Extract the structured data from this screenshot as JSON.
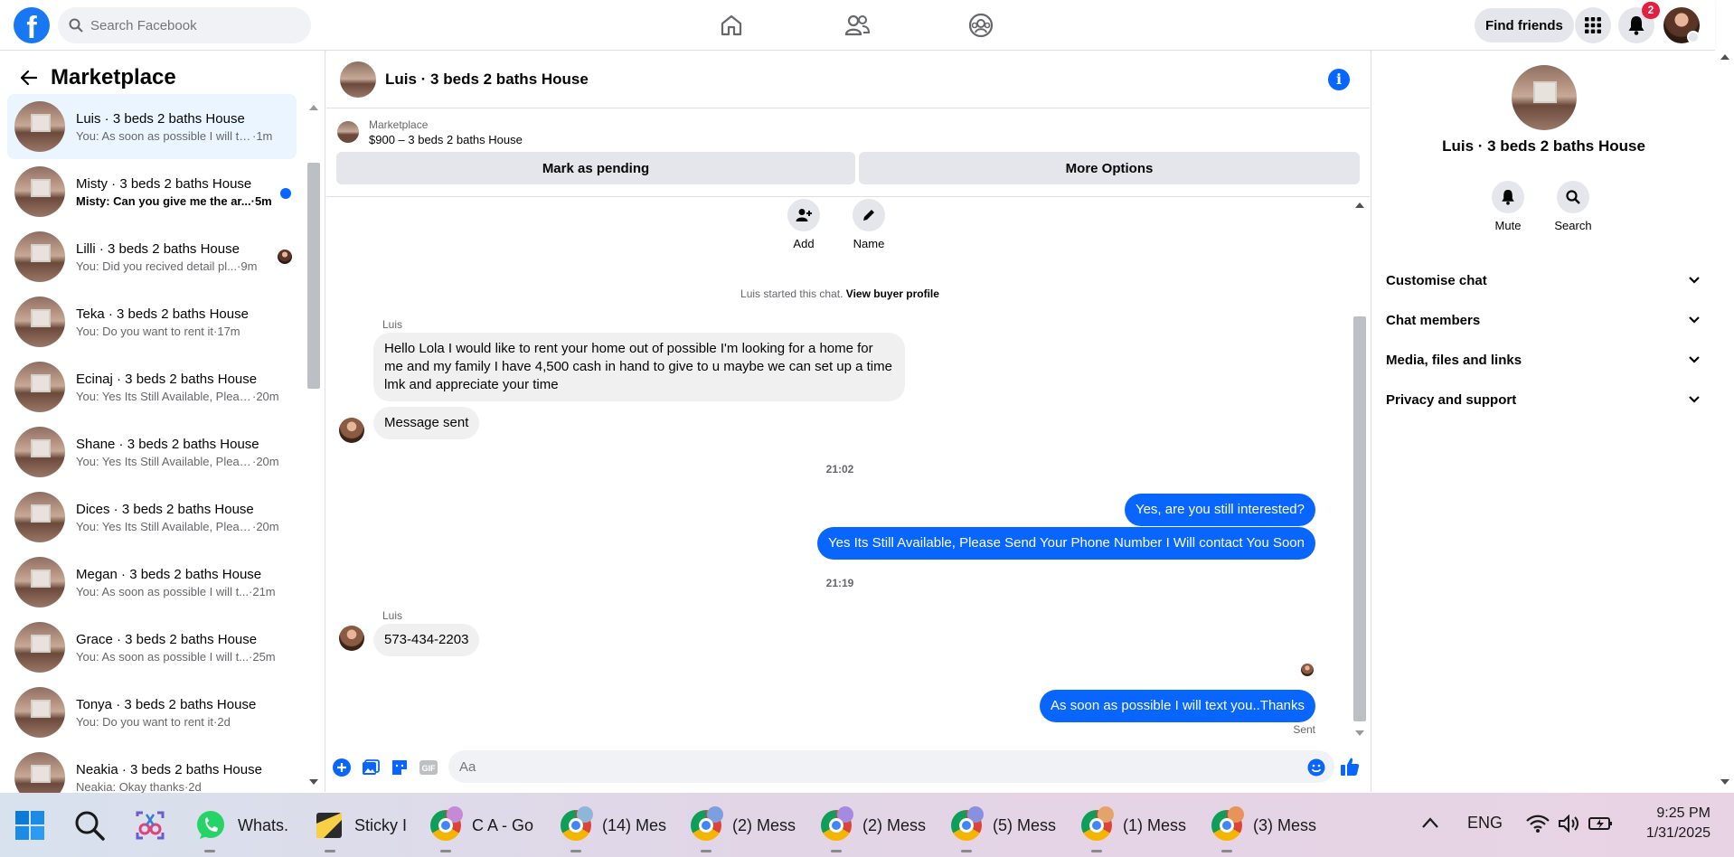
{
  "topbar": {
    "logo_letter": "f",
    "search_placeholder": "Search Facebook",
    "find_friends_label": "Find friends",
    "notification_count": "2",
    "nav_icons": [
      "home-icon",
      "friends-icon",
      "groups-icon"
    ]
  },
  "sidebar": {
    "title": "Marketplace",
    "conversations": [
      {
        "name": "Luis · 3 beds 2 baths House",
        "preview": "You: As soon as possible I will te...",
        "time": "·1m",
        "active": true,
        "unread": false,
        "seen": false
      },
      {
        "name": "Misty · 3 beds 2 baths House",
        "preview": "Misty: Can you give me the ar...",
        "time": "·5m",
        "active": false,
        "unread": true,
        "seen": false
      },
      {
        "name": "Lilli · 3 beds 2 baths House",
        "preview": "You: Did you recived detail pl...",
        "time": "·9m",
        "active": false,
        "unread": false,
        "seen": true
      },
      {
        "name": "Teka · 3 beds 2 baths House",
        "preview": "You: Do you want to rent it",
        "time": "·17m",
        "active": false,
        "unread": false,
        "seen": false
      },
      {
        "name": "Ecinaj · 3 beds 2 baths House",
        "preview": "You: Yes Its Still Available, Pleas...",
        "time": "·20m",
        "active": false,
        "unread": false,
        "seen": false
      },
      {
        "name": "Shane · 3 beds 2 baths House",
        "preview": "You: Yes Its Still Available, Pleas...",
        "time": "·20m",
        "active": false,
        "unread": false,
        "seen": false
      },
      {
        "name": "Dices · 3 beds 2 baths House",
        "preview": "You: Yes Its Still Available, Pleas...",
        "time": "·20m",
        "active": false,
        "unread": false,
        "seen": false
      },
      {
        "name": "Megan · 3 beds 2 baths House",
        "preview": "You: As soon as possible I will t...",
        "time": "·21m",
        "active": false,
        "unread": false,
        "seen": false
      },
      {
        "name": "Grace · 3 beds 2 baths House",
        "preview": "You: As soon as possible I will t...",
        "time": "·25m",
        "active": false,
        "unread": false,
        "seen": false
      },
      {
        "name": "Tonya · 3 beds 2 baths House",
        "preview": "You: Do you want to rent it",
        "time": "·2d",
        "active": false,
        "unread": false,
        "seen": false
      },
      {
        "name": "Neakia · 3 beds 2 baths House",
        "preview": "Neakia: Okay thanks",
        "time": "·2d",
        "active": false,
        "unread": false,
        "seen": false
      }
    ]
  },
  "chat": {
    "title": "Luis · 3 beds 2 baths House",
    "listing_label": "Marketplace",
    "listing_detail": "$900 – 3 beds 2 baths House",
    "mark_pending_label": "Mark as pending",
    "more_options_label": "More Options",
    "quick_actions": {
      "add": "Add",
      "name": "Name"
    },
    "system_note_prefix": "Luis started this chat.",
    "system_note_link": "View buyer profile",
    "sender_name_1": "Luis",
    "incoming_1": "Hello Lola I would like to rent your home out of possible I'm looking for a home for me and my family I have 4,500 cash in hand to give to u maybe we can set up a time lmk and appreciate your time",
    "incoming_2": "Message sent",
    "time_1": "21:02",
    "outgoing_1": "Yes, are you still interested?",
    "outgoing_2": "Yes Its Still Available, Please Send Your Phone Number I Will contact You Soon",
    "time_2": "21:19",
    "sender_name_2": "Luis",
    "incoming_3": "573-434-2203",
    "outgoing_3": "As soon as possible I will text you..Thanks",
    "sent_status": "Sent",
    "composer_placeholder": "Aa"
  },
  "right_panel": {
    "name": "Luis · 3 beds 2 baths House",
    "mute_label": "Mute",
    "search_label": "Search",
    "sections": [
      "Customise chat",
      "Chat members",
      "Media, files and links",
      "Privacy and support"
    ]
  },
  "taskbar": {
    "items": [
      {
        "label": "Whats."
      },
      {
        "label": "Sticky I"
      },
      {
        "label": "C A - Go"
      },
      {
        "label": "(14) Mes"
      },
      {
        "label": "(2) Mess"
      },
      {
        "label": "(2) Mess"
      },
      {
        "label": "(5) Mess"
      },
      {
        "label": "(1) Mess"
      },
      {
        "label": "(3) Mess"
      }
    ],
    "language": "ENG",
    "time": "9:25 PM",
    "date": "1/31/2025"
  },
  "colors": {
    "accent": "#0866ff",
    "facebook_blue": "#1877f2",
    "badge_red": "#e41e3f"
  }
}
